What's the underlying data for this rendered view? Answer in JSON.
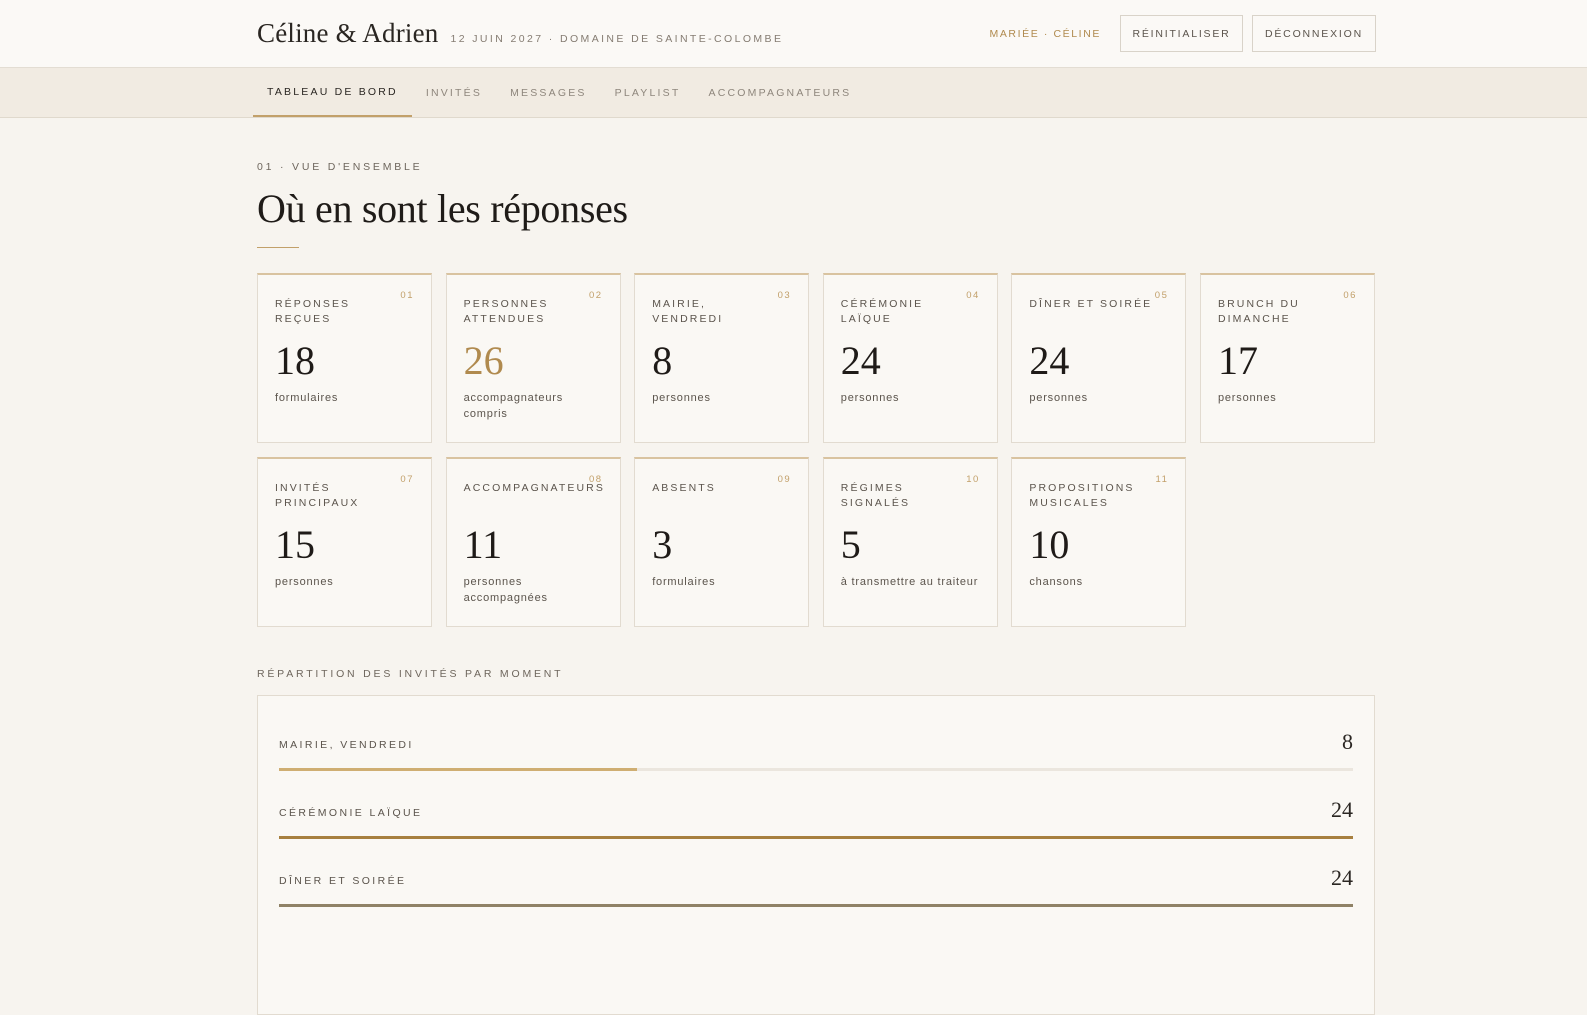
{
  "header": {
    "couple": "Céline & Adrien",
    "meta": "12 JUIN 2027 · DOMAINE DE SAINTE-COLOMBE",
    "user": "MARIÉE · CÉLINE",
    "reset_label": "RÉINITIALISER",
    "logout_label": "DÉCONNEXION"
  },
  "nav": {
    "tabs": [
      {
        "label": "TABLEAU DE BORD",
        "active": true
      },
      {
        "label": "INVITÉS",
        "active": false
      },
      {
        "label": "MESSAGES",
        "active": false
      },
      {
        "label": "PLAYLIST",
        "active": false
      },
      {
        "label": "ACCOMPAGNATEURS",
        "active": false
      }
    ]
  },
  "overview": {
    "eyebrow": "01 · VUE D'ENSEMBLE",
    "title": "Où en sont les réponses"
  },
  "cards": [
    {
      "num": "01",
      "label": "Réponses reçues",
      "value": "18",
      "unit": "formulaires",
      "accent": false
    },
    {
      "num": "02",
      "label": "Personnes attendues",
      "value": "26",
      "unit": "accompagnateurs compris",
      "accent": true
    },
    {
      "num": "03",
      "label": "Mairie, vendredi",
      "value": "8",
      "unit": "personnes",
      "accent": false
    },
    {
      "num": "04",
      "label": "Cérémonie laïque",
      "value": "24",
      "unit": "personnes",
      "accent": false
    },
    {
      "num": "05",
      "label": "Dîner et soirée",
      "value": "24",
      "unit": "personnes",
      "accent": false
    },
    {
      "num": "06",
      "label": "Brunch du dimanche",
      "value": "17",
      "unit": "personnes",
      "accent": false
    },
    {
      "num": "07",
      "label": "Invités principaux",
      "value": "15",
      "unit": "personnes",
      "accent": false
    },
    {
      "num": "08",
      "label": "Accompagnateurs",
      "value": "11",
      "unit": "personnes accompagnées",
      "accent": false
    },
    {
      "num": "09",
      "label": "Absents",
      "value": "3",
      "unit": "formulaires",
      "accent": false
    },
    {
      "num": "10",
      "label": "Régimes signalés",
      "value": "5",
      "unit": "à transmettre au traiteur",
      "accent": false
    },
    {
      "num": "11",
      "label": "Propositions musicales",
      "value": "10",
      "unit": "chansons",
      "accent": false
    }
  ],
  "distribution": {
    "label": "RÉPARTITION DES INVITÉS PAR MOMENT",
    "max": 24,
    "rows": [
      {
        "name": "MAIRIE, VENDREDI",
        "count": 8,
        "color": "#cfae72"
      },
      {
        "name": "CÉRÉMONIE LAÏQUE",
        "count": 24,
        "color": "#a7803f"
      },
      {
        "name": "DÎNER ET SOIRÉE",
        "count": 24,
        "color": "#8f8266"
      }
    ]
  }
}
